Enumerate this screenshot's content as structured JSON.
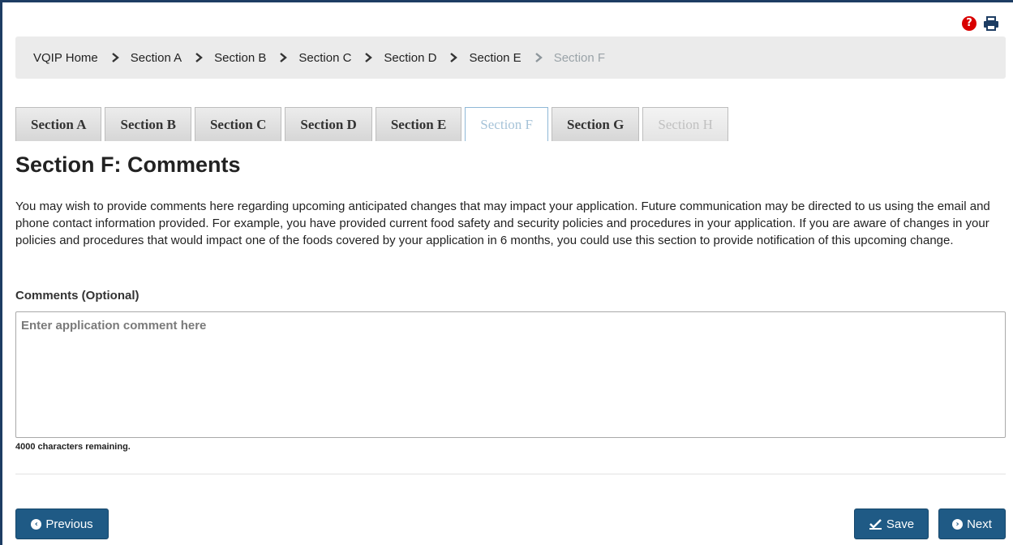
{
  "breadcrumb": [
    {
      "label": "VQIP Home",
      "current": false
    },
    {
      "label": "Section A",
      "current": false
    },
    {
      "label": "Section B",
      "current": false
    },
    {
      "label": "Section C",
      "current": false
    },
    {
      "label": "Section D",
      "current": false
    },
    {
      "label": "Section E",
      "current": false
    },
    {
      "label": "Section F",
      "current": true
    }
  ],
  "tabs": [
    {
      "label": "Section A",
      "state": "normal"
    },
    {
      "label": "Section B",
      "state": "normal"
    },
    {
      "label": "Section C",
      "state": "normal"
    },
    {
      "label": "Section D",
      "state": "normal"
    },
    {
      "label": "Section E",
      "state": "normal"
    },
    {
      "label": "Section F",
      "state": "active"
    },
    {
      "label": "Section G",
      "state": "normal"
    },
    {
      "label": "Section H",
      "state": "disabled"
    }
  ],
  "page": {
    "title": "Section F: Comments",
    "intro": "You may wish to provide comments here regarding upcoming anticipated changes that may impact your application. Future communication may be directed to us using the email and phone contact information provided. For example, you have provided current food safety and security policies and procedures in your application. If you are aware of changes in your policies and procedures that would impact one of the foods covered by your application in 6 months, you could use this section to provide notification of this upcoming change."
  },
  "comments": {
    "label": "Comments (Optional)",
    "placeholder": "Enter application comment here",
    "value": "",
    "remaining": "4000 characters remaining."
  },
  "buttons": {
    "previous": "Previous",
    "save": "Save",
    "next": "Next"
  },
  "icons": {
    "help": "question-circle-icon",
    "print": "print-icon",
    "breadcrumb_separator": "chevron-right-icon",
    "previous": "chevron-circle-left-icon",
    "save": "check-square-icon",
    "next": "chevron-circle-right-icon"
  },
  "colors": {
    "primary_button": "#1f5a85",
    "frame_border": "#1d3d63",
    "help_icon": "#d90000",
    "active_tab_text": "#a6c3d8"
  }
}
